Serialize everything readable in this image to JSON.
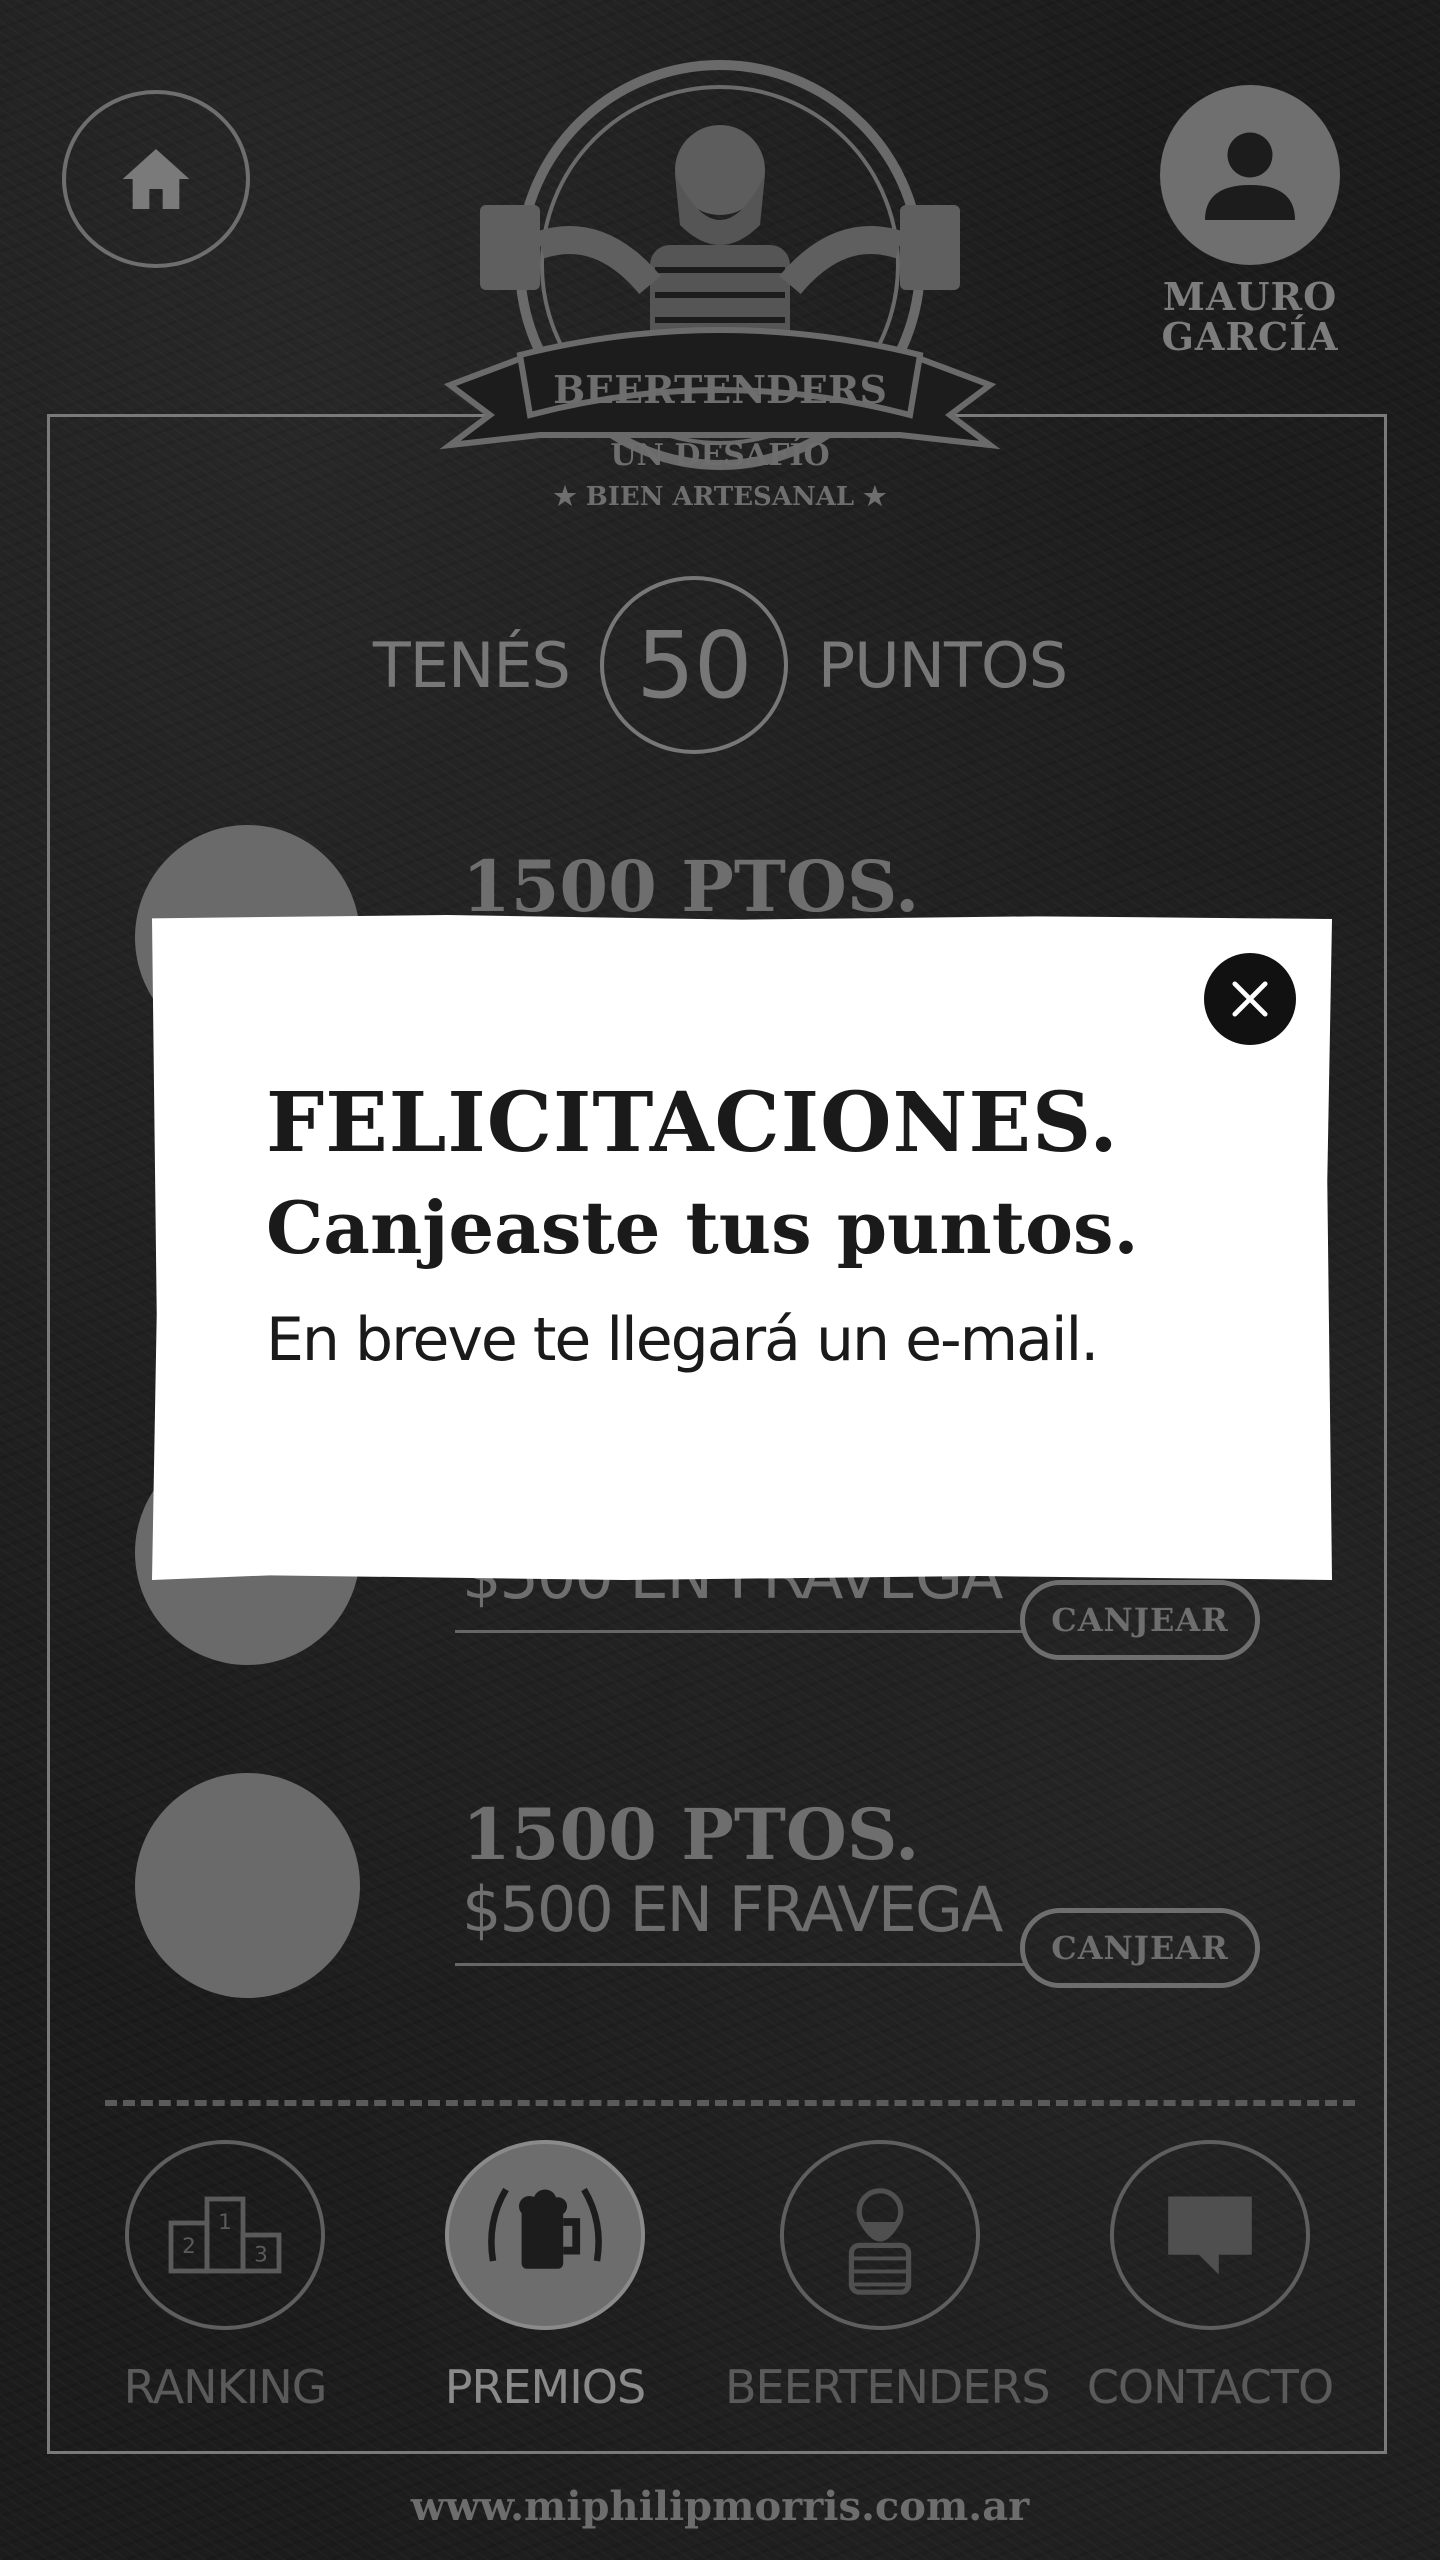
{
  "header": {
    "home_icon": "home-icon",
    "logo": {
      "brand": "BEERTENDERS",
      "tagline_1": "UN DESAFÍO",
      "tagline_2": "★ BIEN ARTESANAL ★"
    },
    "user": {
      "first_name": "MAURO",
      "last_name": "GARCÍA",
      "icon": "user-avatar-icon"
    }
  },
  "points": {
    "prefix": "TENÉS",
    "value": "50",
    "suffix": "PUNTOS"
  },
  "prizes": [
    {
      "points": "1500 PTOS.",
      "description": "",
      "button": ""
    },
    {
      "points": "",
      "description": "$500 EN FRAVEGA",
      "button": "CANJEAR"
    },
    {
      "points": "1500 PTOS.",
      "description": "$500 EN FRAVEGA",
      "button": "CANJEAR"
    }
  ],
  "nav": [
    {
      "label": "RANKING",
      "icon": "podium-icon",
      "active": false
    },
    {
      "label": "PREMIOS",
      "icon": "beer-mug-icon",
      "active": true
    },
    {
      "label": "BEERTENDERS",
      "icon": "bartender-icon",
      "active": false
    },
    {
      "label": "CONTACTO",
      "icon": "chat-icon",
      "active": false
    }
  ],
  "footer": {
    "url": "www.miphilipmorris.com.ar"
  },
  "modal": {
    "title": "FELICITACIONES.",
    "subtitle": "Canjeaste tus puntos.",
    "message": "En breve te llegará un e-mail.",
    "close_icon": "close-icon"
  }
}
